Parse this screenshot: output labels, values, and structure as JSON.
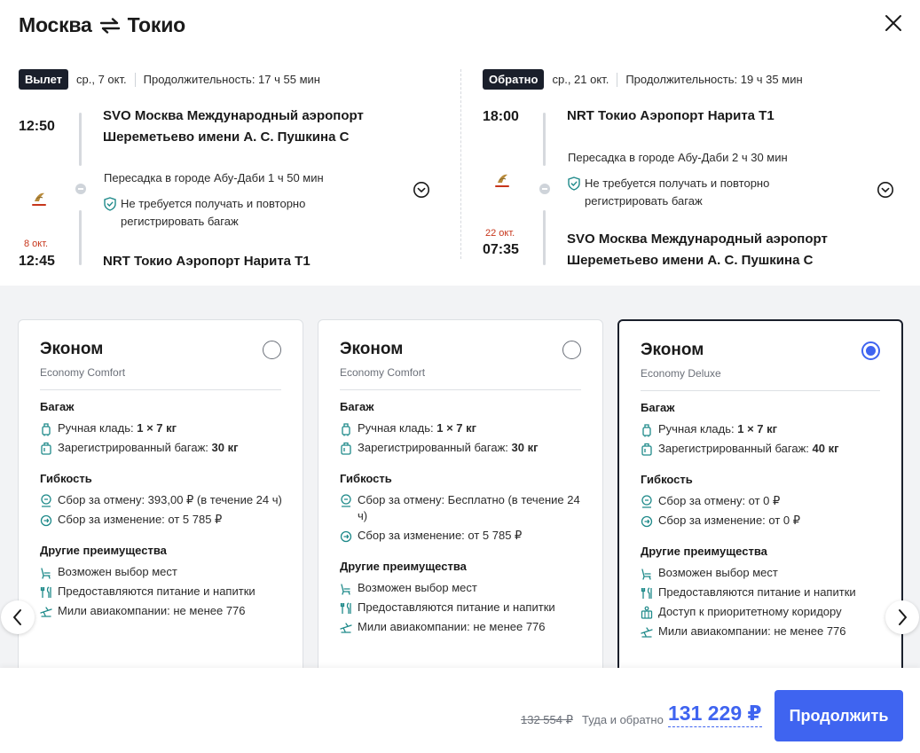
{
  "header": {
    "from": "Москва",
    "to": "Токио"
  },
  "outbound": {
    "badge": "Вылет",
    "date": "ср., 7 окт.",
    "duration": "Продолжительность: 17 ч 55 мин",
    "dep_time": "12:50",
    "dep_airport_line1": "SVO Москва Международный аэропорт",
    "dep_airport_line2": "Шереметьево имени А. С. Пушкина C",
    "transfer": "Пересадка в городе Абу-Даби  1 ч 50 мин",
    "baggage_note_line1": "Не требуется получать и повторно",
    "baggage_note_line2": "регистрировать багаж",
    "arr_date": "8 окт.",
    "arr_time": "12:45",
    "arr_airport": "NRT Токио Аэропорт Нарита T1"
  },
  "return": {
    "badge": "Обратно",
    "date": "ср., 21 окт.",
    "duration": "Продолжительность: 19 ч 35 мин",
    "dep_time": "18:00",
    "dep_airport": "NRT Токио Аэропорт Нарита T1",
    "transfer": "Пересадка в городе Абу-Даби  2 ч 30 мин",
    "baggage_note_line1": "Не требуется получать и повторно",
    "baggage_note_line2": "регистрировать багаж",
    "arr_date": "22 окт.",
    "arr_time": "07:35",
    "arr_airport_line1": "SVO Москва Международный аэропорт",
    "arr_airport_line2": "Шереметьево имени А. С. Пушкина C"
  },
  "labels": {
    "baggage": "Багаж",
    "flex": "Гибкость",
    "other": "Другие преимущества",
    "carry_on": "Ручная кладь: ",
    "checked": "Зарегистрированный багаж: ",
    "seat": "Возможен выбор мест",
    "meals": "Предоставляются питание и напитки",
    "priority": "Доступ к приоритетному коридору",
    "miles": "Мили авиакомпании: не менее 776"
  },
  "fares": [
    {
      "name": "Эконом",
      "subname": "Economy Comfort",
      "selected": false,
      "carry_on": "1 × 7 кг",
      "checked": "30 кг",
      "cancel": "Сбор за отмену: 393,00 ₽ (в течение 24 ч)",
      "change": "Сбор за изменение: от 5 785 ₽"
    },
    {
      "name": "Эконом",
      "subname": "Economy Comfort",
      "selected": false,
      "carry_on": "1 × 7 кг",
      "checked": "30 кг",
      "cancel": "Сбор за отмену: Бесплатно (в течение 24 ч)",
      "change": "Сбор за изменение: от 5 785 ₽"
    },
    {
      "name": "Эконом",
      "subname": "Economy Deluxe",
      "selected": true,
      "carry_on": "1 × 7 кг",
      "checked": "40 кг",
      "cancel": "Сбор за отмену: от 0 ₽",
      "change": "Сбор за изменение: от 0 ₽"
    }
  ],
  "footer": {
    "old_price": "132 554 ₽",
    "price_label": "Туда и обратно",
    "price": "131 229 ₽",
    "continue": "Продолжить"
  },
  "colors": {
    "accent": "#3f64f0",
    "dark": "#1a1f2b",
    "red_date": "#c7361b"
  }
}
